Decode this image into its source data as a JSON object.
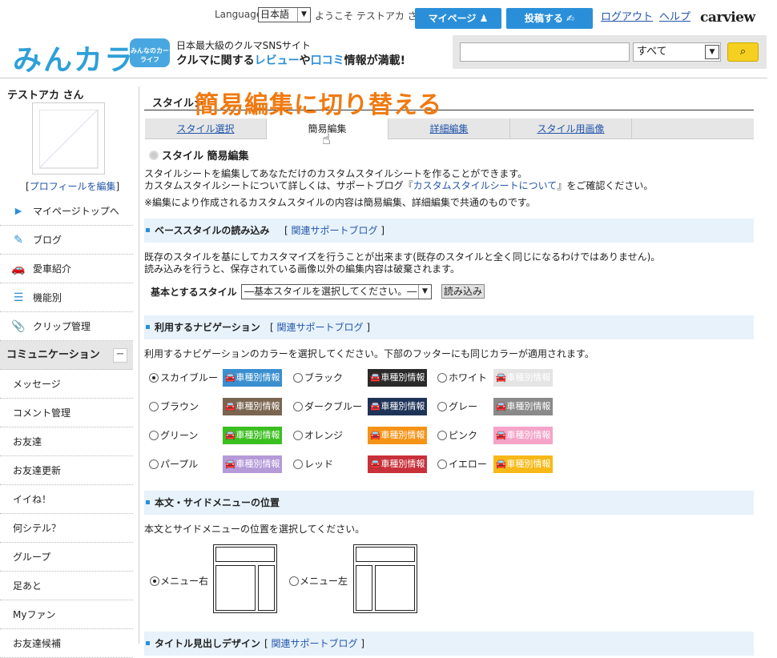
{
  "header": {
    "language_label": "Language",
    "language_value": "日本語",
    "welcome": "ようこそ テストアカ さん",
    "mypage_label": "マイページ ♟",
    "post_label": "投稿する ✍",
    "logout_label": "ログアウト",
    "help_label": "ヘルプ",
    "carview_logo": "carview",
    "logo_text": "みんカラ",
    "logo_car_text": "みんなのカーライフ",
    "tagline1": "日本最大級のクルマSNSサイト",
    "tagline2_a": "クルマに関する",
    "tagline2_b": "レビュー",
    "tagline2_c": "や",
    "tagline2_d": "口コミ",
    "tagline2_e": "情報が満載!",
    "search_placeholder": "",
    "search_scope": "すべて",
    "search_icon": "magnifier-icon"
  },
  "sidebar": {
    "user_name": "テストアカ さん",
    "edit_profile": "プロフィールを編集",
    "items": [
      {
        "label": "マイページトップへ",
        "icon": "▶"
      },
      {
        "label": "ブログ",
        "icon": "✎"
      },
      {
        "label": "愛車紹介",
        "icon": "🚗"
      },
      {
        "label": "機能別",
        "icon": "☰"
      },
      {
        "label": "クリップ管理",
        "icon": "📎"
      }
    ],
    "section_label": "コミュニケーション",
    "section_toggle": "−",
    "plain_items": [
      "メッセージ",
      "コメント管理",
      "お友達",
      "お友達更新",
      "イイね！",
      "何シテル？",
      "グループ",
      "足あと",
      "Myファン",
      "お友達候補"
    ]
  },
  "main": {
    "title_small": "スタイルシ",
    "title_overlay": "簡易編集に切り替える",
    "tabs": [
      "スタイル選択",
      "簡易編集",
      "詳細編集",
      "スタイル用画像"
    ],
    "section_title": "スタイル 簡易編集",
    "intro1": "スタイルシートを編集してあなただけのカスタムスタイルシートを作ることができます。",
    "intro2_a": "カスタムスタイルシートについて詳しくは、サポートブログ『",
    "intro2_link": "カスタムスタイルシートについて",
    "intro2_b": "』をご確認ください。",
    "intro3": "※編集により作成されるカスタムスタイルの内容は簡易編集、詳細編集で共通のものです。",
    "base": {
      "title": "ベーススタイルの読み込み",
      "link": "関連サポートブログ",
      "desc1": "既存のスタイルを基にしてカスタマイズを行うことが出来ます(既存のスタイルと全く同じになるわけではありません)。",
      "desc2": "読み込みを行うと、保存されている画像以外の編集内容は破棄されます。",
      "label": "基本とするスタイル",
      "select": "―基本スタイルを選択してください。―",
      "button": "読み込み"
    },
    "nav": {
      "title": "利用するナビゲーション",
      "link": "関連サポートブログ",
      "desc": "利用するナビゲーションのカラーを選択してください。下部のフッターにも同じカラーが適用されます。",
      "swatch_text": "🚘車種別情報",
      "options": [
        {
          "label": "スカイブルー",
          "color": "#3a8fcf",
          "selected": true
        },
        {
          "label": "ブラック",
          "color": "#2a2a2a",
          "selected": false
        },
        {
          "label": "ホワイト",
          "color": "#e4e4e4",
          "selected": false
        },
        {
          "label": "ブラウン",
          "color": "#7a6550",
          "selected": false
        },
        {
          "label": "ダークブルー",
          "color": "#1d3358",
          "selected": false
        },
        {
          "label": "グレー",
          "color": "#8a8a8a",
          "selected": false
        },
        {
          "label": "グリーン",
          "color": "#3bbf1f",
          "selected": false
        },
        {
          "label": "オレンジ",
          "color": "#f59316",
          "selected": false
        },
        {
          "label": "ピンク",
          "color": "#f5a3c8",
          "selected": false
        },
        {
          "label": "パープル",
          "color": "#b59ad8",
          "selected": false
        },
        {
          "label": "レッド",
          "color": "#c8303a",
          "selected": false
        },
        {
          "label": "イエロー",
          "color": "#f7b918",
          "selected": false
        }
      ]
    },
    "position": {
      "title": "本文・サイドメニューの位置",
      "desc": "本文とサイドメニューの位置を選択してください。",
      "opt_right": "メニュー右",
      "opt_left": "メニュー左",
      "selected": "right"
    },
    "next_section_title": "タイトル見出しデザイン",
    "next_section_link": "関連サポートブログ"
  },
  "colors": {
    "accent": "#2a8fd8",
    "overlay": "#f07a10",
    "bar_bg": "#e7f2fb"
  }
}
